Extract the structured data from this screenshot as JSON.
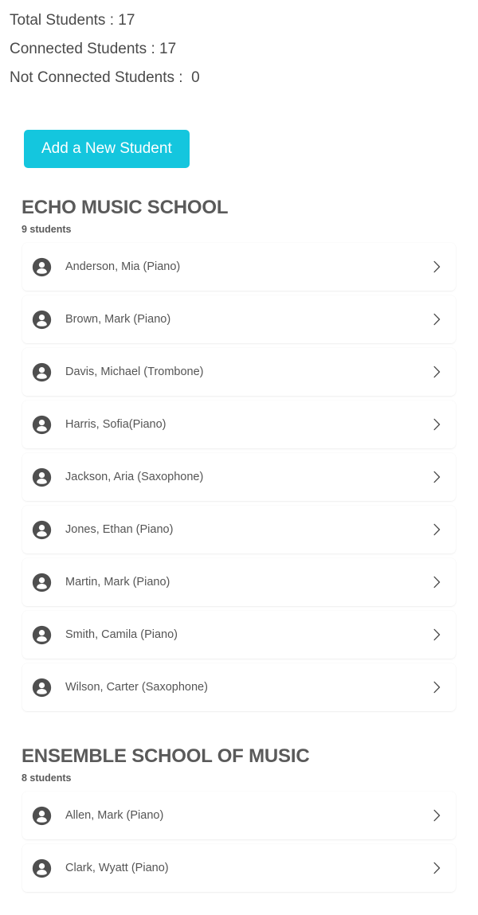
{
  "summary": {
    "total_students": "Total Students : 17",
    "connected_students": "Connected Students : 17",
    "not_connected_students": "Not Connected Students :  0"
  },
  "toolbar": {
    "add_student_label": "Add a New Student",
    "accent_color": "#14c6de"
  },
  "sections": [
    {
      "title": "ECHO MUSIC SCHOOL",
      "count_label": "9 students",
      "students": [
        {
          "name": "Anderson, Mia (Piano)"
        },
        {
          "name": "Brown, Mark (Piano)"
        },
        {
          "name": "Davis, Michael (Trombone)"
        },
        {
          "name": "Harris, Sofia(Piano)"
        },
        {
          "name": "Jackson, Aria (Saxophone)"
        },
        {
          "name": "Jones, Ethan (Piano)"
        },
        {
          "name": "Martin, Mark (Piano)"
        },
        {
          "name": "Smith, Camila (Piano)"
        },
        {
          "name": "Wilson, Carter (Saxophone)"
        }
      ]
    },
    {
      "title": "ENSEMBLE SCHOOL OF MUSIC",
      "count_label": "8 students",
      "students": [
        {
          "name": "Allen, Mark (Piano)"
        },
        {
          "name": "Clark, Wyatt (Piano)"
        }
      ]
    }
  ],
  "icons": {
    "avatar": "account-circle-icon",
    "chevron": "chevron-right-icon"
  }
}
